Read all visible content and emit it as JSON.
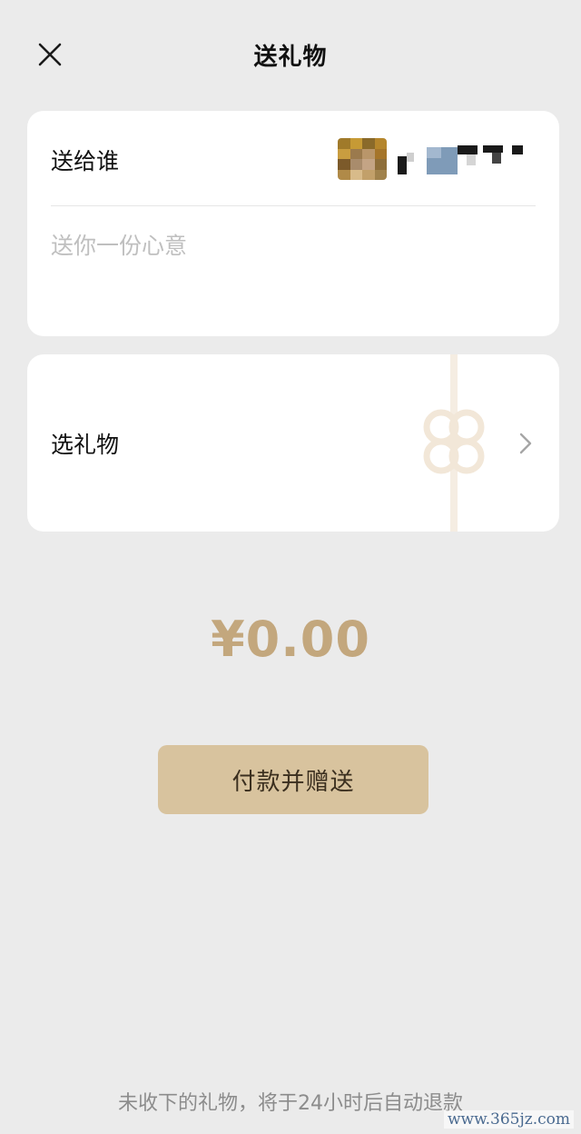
{
  "header": {
    "title": "送礼物",
    "close_icon": "close-icon"
  },
  "recipient": {
    "label": "送给谁",
    "message_placeholder": "送你一份心意",
    "message_value": ""
  },
  "gift": {
    "label": "选礼物",
    "chevron_icon": "chevron-right-icon",
    "decoration_icon": "ribbon-bow-icon"
  },
  "amount": {
    "display": "¥0.00"
  },
  "pay_button": {
    "label": "付款并赠送"
  },
  "footer": {
    "refund_note": "未收下的礼物，将于24小时后自动退款",
    "watermark": "www.365jz.com"
  },
  "colors": {
    "background": "#ebebeb",
    "card": "#ffffff",
    "accent_gold": "#c3a77d",
    "button": "#d8c39e"
  }
}
